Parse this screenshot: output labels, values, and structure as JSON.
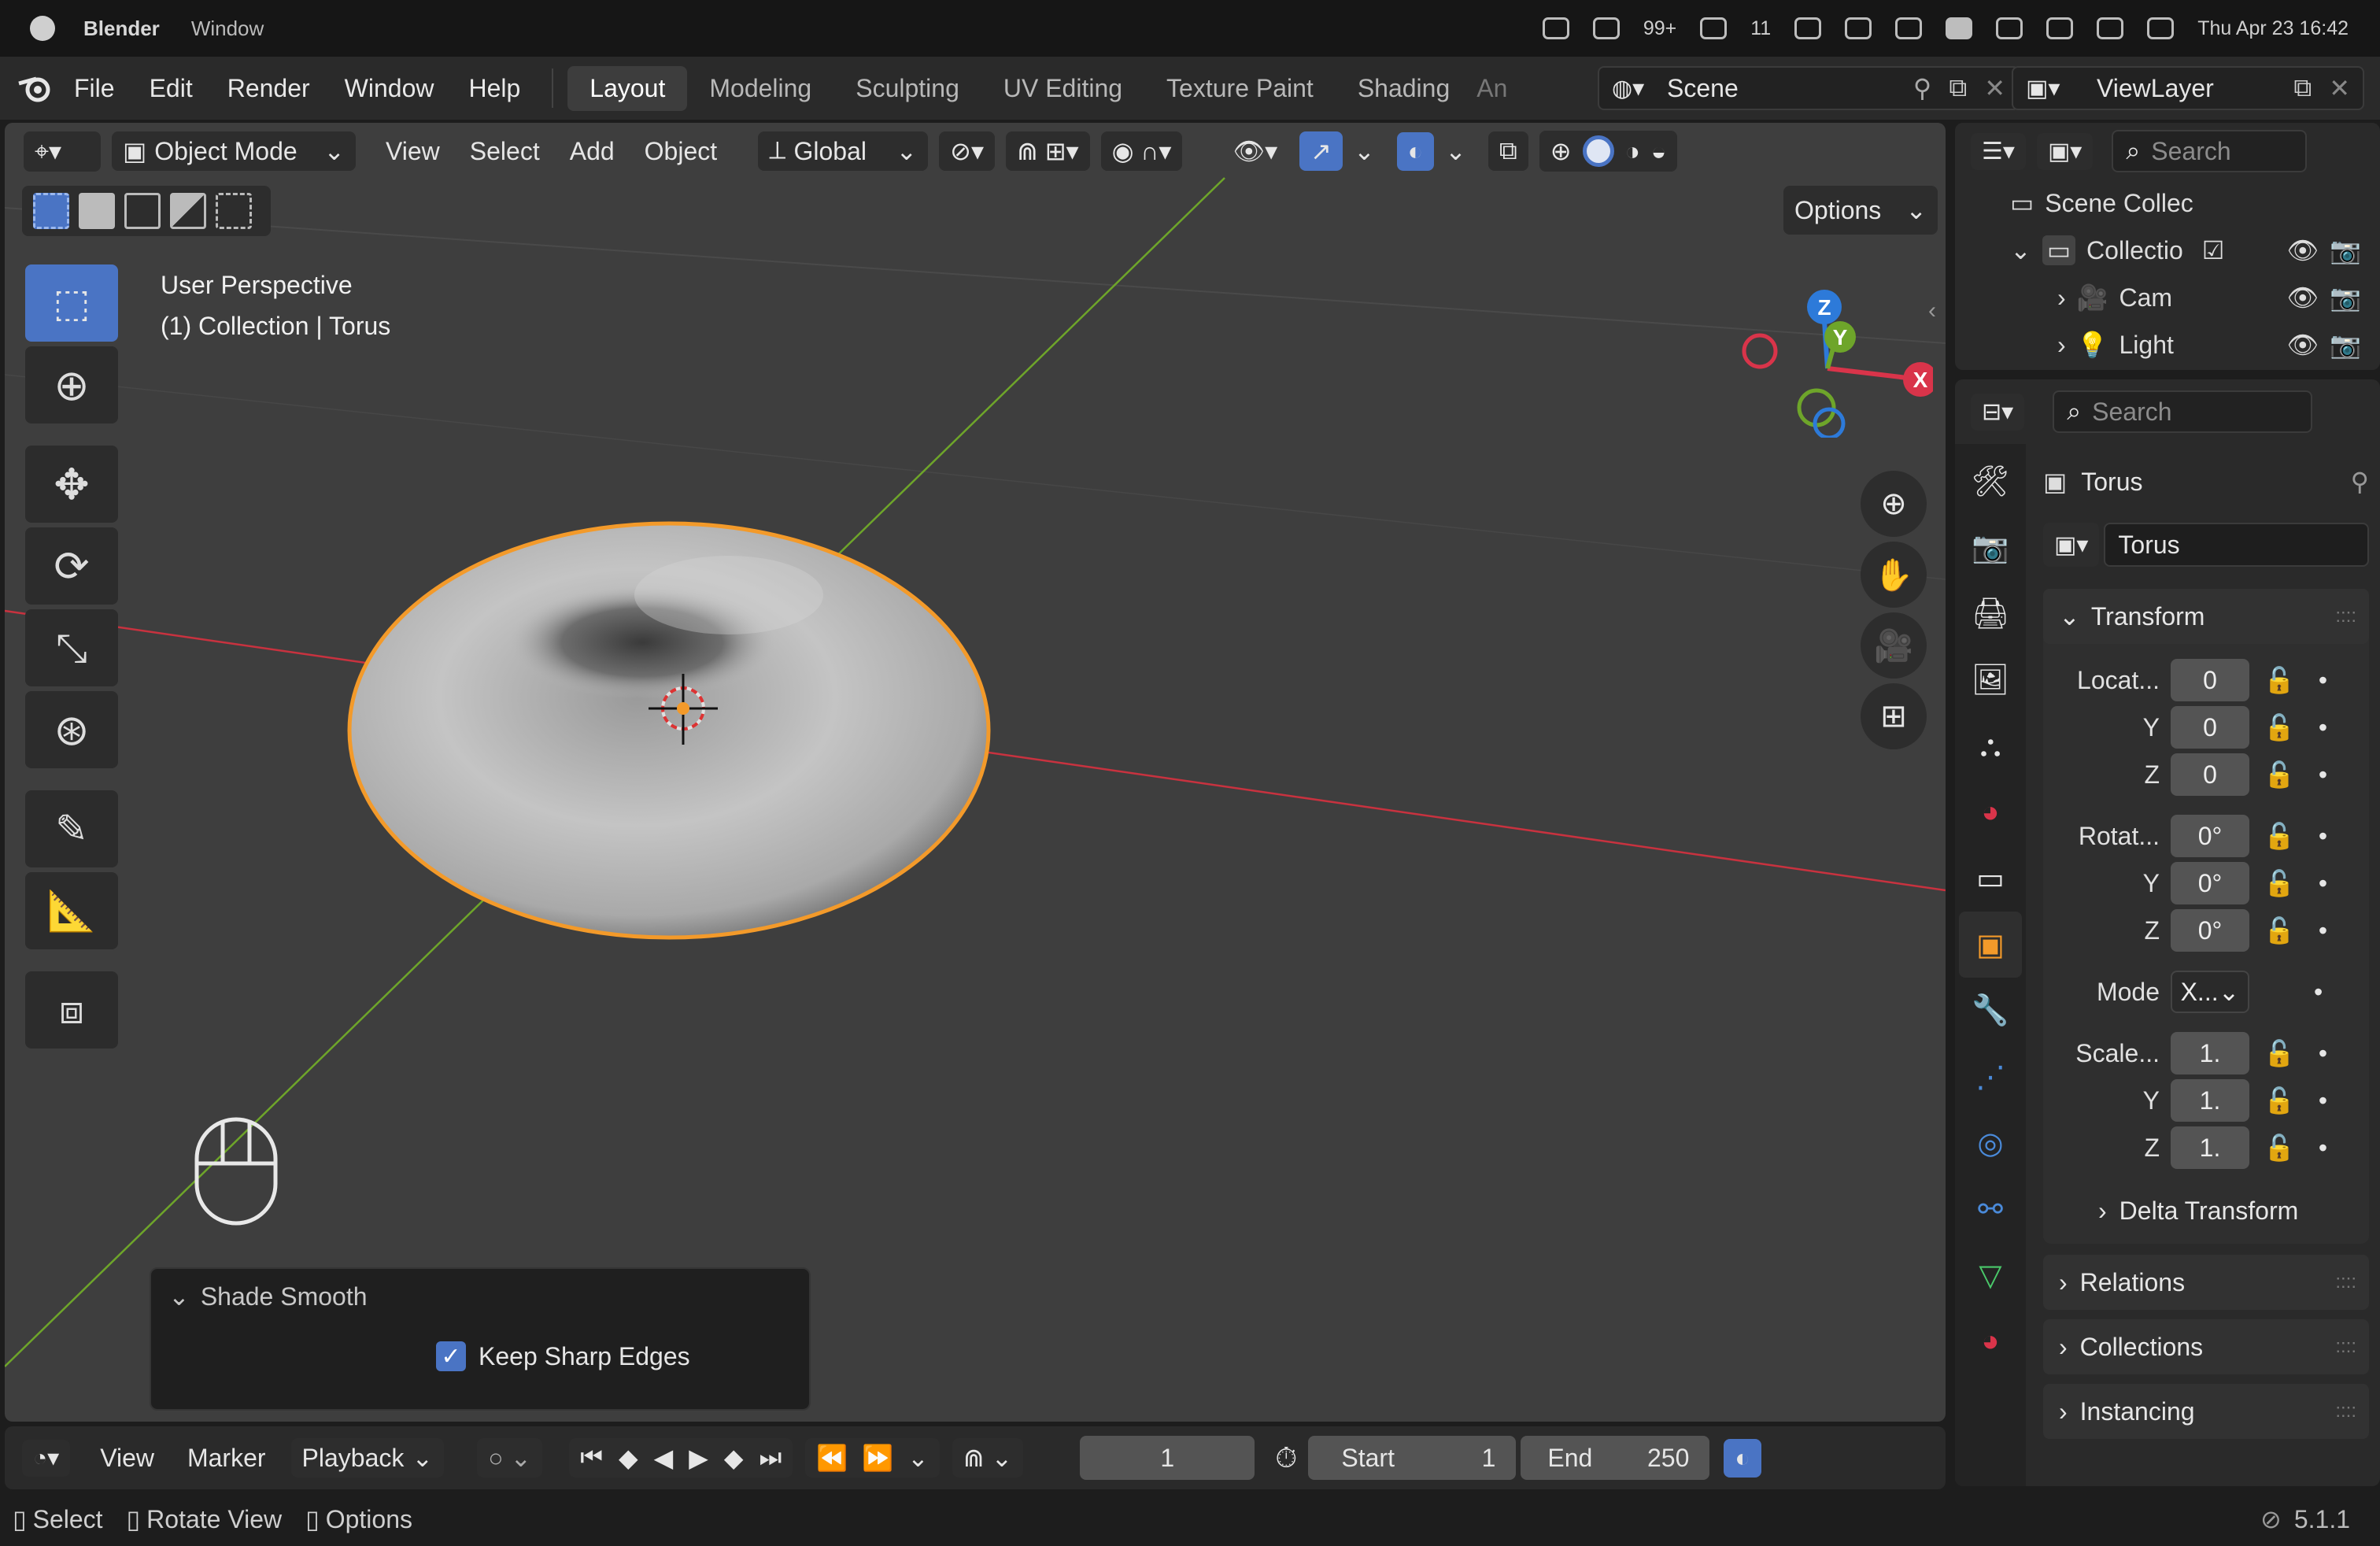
{
  "macbar": {
    "app_name": "Blender",
    "window_menu": "Window",
    "notif_count_1": "99+",
    "notif_count_2": "11",
    "datetime": "Thu Apr 23  16:42"
  },
  "topbar": {
    "menus": [
      "File",
      "Edit",
      "Render",
      "Window",
      "Help"
    ],
    "workspaces": [
      "Layout",
      "Modeling",
      "Sculpting",
      "UV Editing",
      "Texture Paint",
      "Shading",
      "An"
    ],
    "active_workspace": "Layout",
    "scene": "Scene",
    "view_layer": "ViewLayer"
  },
  "viewport_header": {
    "mode": "Object Mode",
    "menus": [
      "View",
      "Select",
      "Add",
      "Object"
    ],
    "orientation": "Global",
    "options_label": "Options"
  },
  "viewport": {
    "perspective_label": "User Perspective",
    "collection_label": "(1) Collection | Torus",
    "gizmo_axes": {
      "x": "X",
      "y": "Y",
      "z": "Z"
    },
    "colors": {
      "x_axis": "#d9344a",
      "y_axis": "#6ea52a",
      "z_axis": "#2d7ad9",
      "selection": "#f39a2a",
      "active_tool": "#4a74c4"
    }
  },
  "operator_panel": {
    "title": "Shade Smooth",
    "checkbox_label": "Keep Sharp Edges",
    "checkbox_checked": true
  },
  "outliner": {
    "search_placeholder": "Search",
    "root": "Scene Collec",
    "collection": "Collectio",
    "items": [
      "Cam",
      "Light"
    ]
  },
  "properties": {
    "search_placeholder": "Search",
    "object_name": "Torus",
    "object_field": "Torus",
    "transform_title": "Transform",
    "location": {
      "label": "Locat...",
      "x": "0",
      "y": "0",
      "z": "0"
    },
    "rotation": {
      "label": "Rotat...",
      "x": "0°",
      "y": "0°",
      "z": "0°"
    },
    "mode": {
      "label": "Mode",
      "value": "X..."
    },
    "scale": {
      "label": "Scale...",
      "x": "1.",
      "y": "1.",
      "z": "1."
    },
    "axis_y": "Y",
    "axis_z": "Z",
    "delta_transform": "Delta Transform",
    "collapsed_panels": [
      "Relations",
      "Collections",
      "Instancing"
    ]
  },
  "timeline": {
    "menus": [
      "View",
      "Marker"
    ],
    "playback": "Playback",
    "current_frame": "1",
    "start_label": "Start",
    "start_value": "1",
    "end_label": "End",
    "end_value": "250"
  },
  "statusbar": {
    "hints": [
      "Select",
      "Rotate View",
      "Options"
    ],
    "version": "5.1.1"
  }
}
